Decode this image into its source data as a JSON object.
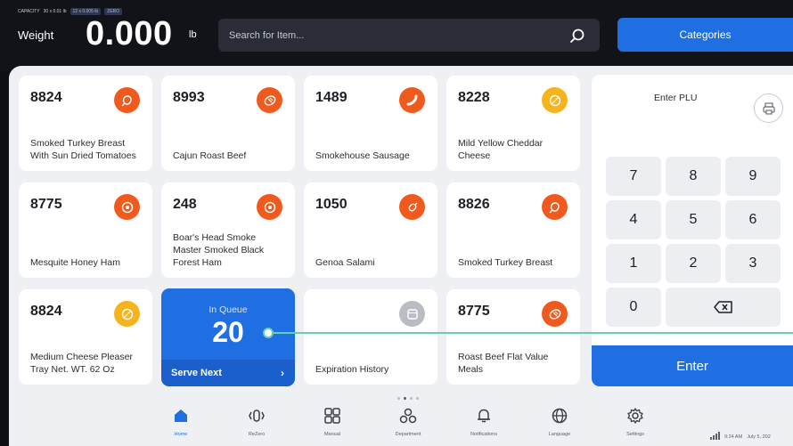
{
  "header": {
    "capacity_label": "CAPACITY",
    "capacity_value": "30 x 0.01 lb",
    "capacity_chip": "12 x 0.005 lb",
    "zero_chip": "ZERO",
    "weight_label": "Weight",
    "weight_value": "0.000",
    "weight_unit": "lb",
    "search_placeholder": "Search for Item...",
    "categories_label": "Categories"
  },
  "items": [
    {
      "plu": "8824",
      "name": "Smoked Turkey Breast With Sun Dried Tomatoes",
      "icon": "turkey-icon",
      "color": "#f05a1f"
    },
    {
      "plu": "8993",
      "name": "Cajun Roast Beef",
      "icon": "roast-beef-icon",
      "color": "#f05a1f"
    },
    {
      "plu": "1489",
      "name": "Smokehouse Sausage",
      "icon": "sausage-icon",
      "color": "#f05a1f"
    },
    {
      "plu": "8228",
      "name": "Mild Yellow Cheddar Cheese",
      "icon": "cheese-icon",
      "color": "#f5b41e"
    },
    {
      "plu": "8775",
      "name": "Mesquite Honey Ham",
      "icon": "ham-icon",
      "color": "#f05a1f"
    },
    {
      "plu": "248",
      "name": "Boar's Head Smoke Master Smoked Black Forest Ham",
      "icon": "ham-icon",
      "color": "#f05a1f"
    },
    {
      "plu": "1050",
      "name": "Genoa Salami",
      "icon": "salami-icon",
      "color": "#f05a1f"
    },
    {
      "plu": "8826",
      "name": "Smoked Turkey Breast",
      "icon": "turkey-icon",
      "color": "#f05a1f"
    },
    {
      "plu": "8824",
      "name": "Medium Cheese Pleaser Tray Net. WT. 62 Oz",
      "icon": "cheese-icon",
      "color": "#f5b41e"
    },
    {
      "plu": "",
      "name": "Expiration History",
      "icon": "history-icon",
      "color": "#b9bcc2"
    },
    {
      "plu": "8775",
      "name": "Roast Beef Flat Value Meals",
      "icon": "roast-beef-icon",
      "color": "#f05a1f"
    }
  ],
  "queue": {
    "label": "In Queue",
    "count": "20",
    "serve_label": "Serve Next",
    "chevron": "›"
  },
  "keypad": {
    "title": "Enter PLU",
    "keys": [
      "7",
      "8",
      "9",
      "4",
      "5",
      "6",
      "1",
      "2",
      "3",
      "0"
    ],
    "enter_label": "Enter"
  },
  "nav": [
    {
      "label": "Home",
      "icon": "home-icon",
      "active": true
    },
    {
      "label": "ReZero",
      "icon": "rezero-icon",
      "active": false
    },
    {
      "label": "Manual",
      "icon": "manual-icon",
      "active": false
    },
    {
      "label": "Department",
      "icon": "department-icon",
      "active": false
    },
    {
      "label": "Notifications",
      "icon": "bell-icon",
      "active": false
    },
    {
      "label": "Language",
      "icon": "globe-icon",
      "active": false
    },
    {
      "label": "Settings",
      "icon": "gear-icon",
      "active": false
    }
  ],
  "status": {
    "time": "9:24 AM",
    "date": "July 5, 202"
  },
  "colors": {
    "accent": "#1f6fe3",
    "meat": "#f05a1f",
    "dairy": "#f5b41e",
    "queue_line": "#5fd2b4"
  }
}
